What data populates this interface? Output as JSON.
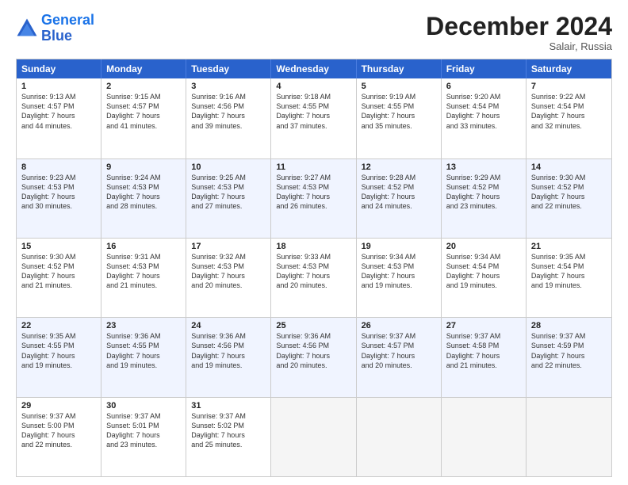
{
  "logo": {
    "line1": "General",
    "line2": "Blue"
  },
  "title": "December 2024",
  "subtitle": "Salair, Russia",
  "header_days": [
    "Sunday",
    "Monday",
    "Tuesday",
    "Wednesday",
    "Thursday",
    "Friday",
    "Saturday"
  ],
  "rows": [
    [
      {
        "day": "1",
        "lines": [
          "Sunrise: 9:13 AM",
          "Sunset: 4:57 PM",
          "Daylight: 7 hours",
          "and 44 minutes."
        ]
      },
      {
        "day": "2",
        "lines": [
          "Sunrise: 9:15 AM",
          "Sunset: 4:57 PM",
          "Daylight: 7 hours",
          "and 41 minutes."
        ]
      },
      {
        "day": "3",
        "lines": [
          "Sunrise: 9:16 AM",
          "Sunset: 4:56 PM",
          "Daylight: 7 hours",
          "and 39 minutes."
        ]
      },
      {
        "day": "4",
        "lines": [
          "Sunrise: 9:18 AM",
          "Sunset: 4:55 PM",
          "Daylight: 7 hours",
          "and 37 minutes."
        ]
      },
      {
        "day": "5",
        "lines": [
          "Sunrise: 9:19 AM",
          "Sunset: 4:55 PM",
          "Daylight: 7 hours",
          "and 35 minutes."
        ]
      },
      {
        "day": "6",
        "lines": [
          "Sunrise: 9:20 AM",
          "Sunset: 4:54 PM",
          "Daylight: 7 hours",
          "and 33 minutes."
        ]
      },
      {
        "day": "7",
        "lines": [
          "Sunrise: 9:22 AM",
          "Sunset: 4:54 PM",
          "Daylight: 7 hours",
          "and 32 minutes."
        ]
      }
    ],
    [
      {
        "day": "8",
        "lines": [
          "Sunrise: 9:23 AM",
          "Sunset: 4:53 PM",
          "Daylight: 7 hours",
          "and 30 minutes."
        ]
      },
      {
        "day": "9",
        "lines": [
          "Sunrise: 9:24 AM",
          "Sunset: 4:53 PM",
          "Daylight: 7 hours",
          "and 28 minutes."
        ]
      },
      {
        "day": "10",
        "lines": [
          "Sunrise: 9:25 AM",
          "Sunset: 4:53 PM",
          "Daylight: 7 hours",
          "and 27 minutes."
        ]
      },
      {
        "day": "11",
        "lines": [
          "Sunrise: 9:27 AM",
          "Sunset: 4:53 PM",
          "Daylight: 7 hours",
          "and 26 minutes."
        ]
      },
      {
        "day": "12",
        "lines": [
          "Sunrise: 9:28 AM",
          "Sunset: 4:52 PM",
          "Daylight: 7 hours",
          "and 24 minutes."
        ]
      },
      {
        "day": "13",
        "lines": [
          "Sunrise: 9:29 AM",
          "Sunset: 4:52 PM",
          "Daylight: 7 hours",
          "and 23 minutes."
        ]
      },
      {
        "day": "14",
        "lines": [
          "Sunrise: 9:30 AM",
          "Sunset: 4:52 PM",
          "Daylight: 7 hours",
          "and 22 minutes."
        ]
      }
    ],
    [
      {
        "day": "15",
        "lines": [
          "Sunrise: 9:30 AM",
          "Sunset: 4:52 PM",
          "Daylight: 7 hours",
          "and 21 minutes."
        ]
      },
      {
        "day": "16",
        "lines": [
          "Sunrise: 9:31 AM",
          "Sunset: 4:53 PM",
          "Daylight: 7 hours",
          "and 21 minutes."
        ]
      },
      {
        "day": "17",
        "lines": [
          "Sunrise: 9:32 AM",
          "Sunset: 4:53 PM",
          "Daylight: 7 hours",
          "and 20 minutes."
        ]
      },
      {
        "day": "18",
        "lines": [
          "Sunrise: 9:33 AM",
          "Sunset: 4:53 PM",
          "Daylight: 7 hours",
          "and 20 minutes."
        ]
      },
      {
        "day": "19",
        "lines": [
          "Sunrise: 9:34 AM",
          "Sunset: 4:53 PM",
          "Daylight: 7 hours",
          "and 19 minutes."
        ]
      },
      {
        "day": "20",
        "lines": [
          "Sunrise: 9:34 AM",
          "Sunset: 4:54 PM",
          "Daylight: 7 hours",
          "and 19 minutes."
        ]
      },
      {
        "day": "21",
        "lines": [
          "Sunrise: 9:35 AM",
          "Sunset: 4:54 PM",
          "Daylight: 7 hours",
          "and 19 minutes."
        ]
      }
    ],
    [
      {
        "day": "22",
        "lines": [
          "Sunrise: 9:35 AM",
          "Sunset: 4:55 PM",
          "Daylight: 7 hours",
          "and 19 minutes."
        ]
      },
      {
        "day": "23",
        "lines": [
          "Sunrise: 9:36 AM",
          "Sunset: 4:55 PM",
          "Daylight: 7 hours",
          "and 19 minutes."
        ]
      },
      {
        "day": "24",
        "lines": [
          "Sunrise: 9:36 AM",
          "Sunset: 4:56 PM",
          "Daylight: 7 hours",
          "and 19 minutes."
        ]
      },
      {
        "day": "25",
        "lines": [
          "Sunrise: 9:36 AM",
          "Sunset: 4:56 PM",
          "Daylight: 7 hours",
          "and 20 minutes."
        ]
      },
      {
        "day": "26",
        "lines": [
          "Sunrise: 9:37 AM",
          "Sunset: 4:57 PM",
          "Daylight: 7 hours",
          "and 20 minutes."
        ]
      },
      {
        "day": "27",
        "lines": [
          "Sunrise: 9:37 AM",
          "Sunset: 4:58 PM",
          "Daylight: 7 hours",
          "and 21 minutes."
        ]
      },
      {
        "day": "28",
        "lines": [
          "Sunrise: 9:37 AM",
          "Sunset: 4:59 PM",
          "Daylight: 7 hours",
          "and 22 minutes."
        ]
      }
    ],
    [
      {
        "day": "29",
        "lines": [
          "Sunrise: 9:37 AM",
          "Sunset: 5:00 PM",
          "Daylight: 7 hours",
          "and 22 minutes."
        ]
      },
      {
        "day": "30",
        "lines": [
          "Sunrise: 9:37 AM",
          "Sunset: 5:01 PM",
          "Daylight: 7 hours",
          "and 23 minutes."
        ]
      },
      {
        "day": "31",
        "lines": [
          "Sunrise: 9:37 AM",
          "Sunset: 5:02 PM",
          "Daylight: 7 hours",
          "and 25 minutes."
        ]
      },
      {
        "day": "",
        "lines": []
      },
      {
        "day": "",
        "lines": []
      },
      {
        "day": "",
        "lines": []
      },
      {
        "day": "",
        "lines": []
      }
    ]
  ]
}
